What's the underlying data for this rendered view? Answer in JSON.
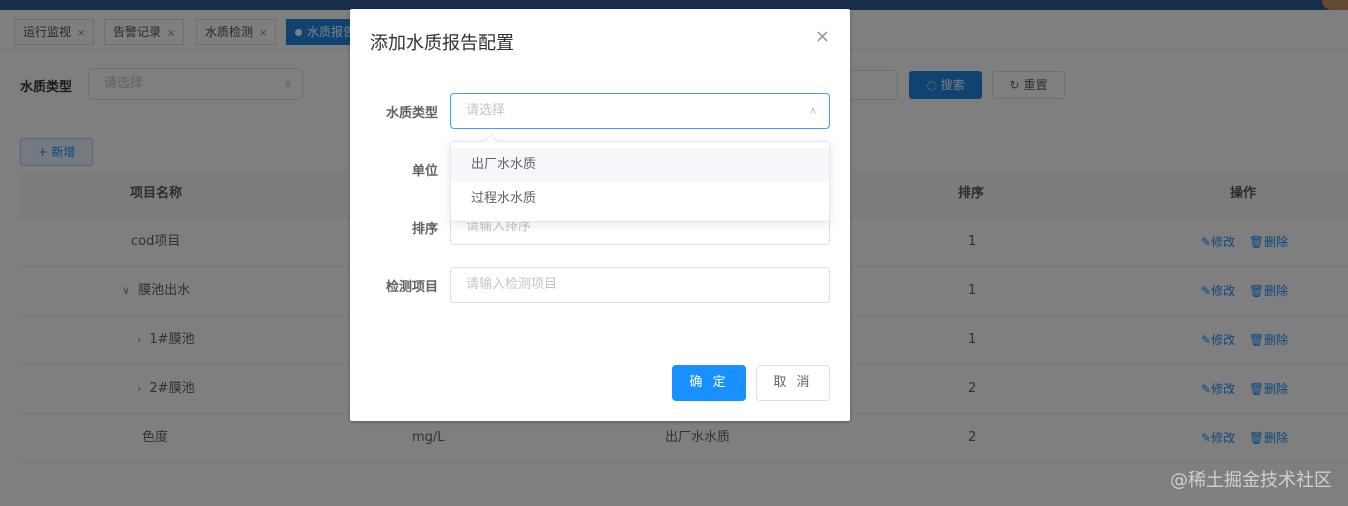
{
  "tags": [
    {
      "label": "运行监视",
      "close": "×"
    },
    {
      "label": "告警记录",
      "close": "×"
    },
    {
      "label": "水质检测",
      "close": "×"
    },
    {
      "label": "水质报告",
      "close": ""
    }
  ],
  "filter": {
    "label": "水质类型",
    "placeholder": "请选择",
    "search_label": "搜索",
    "reset_label": "重置"
  },
  "add_label": "+ 新增",
  "table": {
    "headers": [
      "项目名称",
      "排序",
      "操作"
    ],
    "edit_label": "修改",
    "delete_label": "删除",
    "rows": [
      {
        "name": "cod项目",
        "unit": "",
        "type": "",
        "order": "1",
        "chevron": ""
      },
      {
        "name": "膜池出水",
        "unit": "",
        "type": "",
        "order": "1",
        "chevron": "∨"
      },
      {
        "name": "1#膜池",
        "unit": "",
        "type": "",
        "order": "1",
        "chevron": "›"
      },
      {
        "name": "2#膜池",
        "unit": "",
        "type": "",
        "order": "2",
        "chevron": "›"
      },
      {
        "name": "色度",
        "unit": "mg/L",
        "type": "出厂水水质",
        "order": "2",
        "chevron": ""
      }
    ]
  },
  "dialog": {
    "title": "添加水质报告配置",
    "close": "×",
    "fields": {
      "type_label": "水质类型",
      "type_placeholder": "请选择",
      "unit_label": "单位",
      "order_label": "排序",
      "order_placeholder": "请输入排序",
      "item_label": "检测项目",
      "item_placeholder": "请输入检测项目"
    },
    "options": [
      "出厂水水质",
      "过程水水质"
    ],
    "confirm_label": "确 定",
    "cancel_label": "取 消"
  },
  "watermark": "@稀土掘金技术社区",
  "colors": {
    "primary": "#1890ff",
    "header": "#2f5f94",
    "mask": "rgba(0,0,0,0.5)"
  }
}
